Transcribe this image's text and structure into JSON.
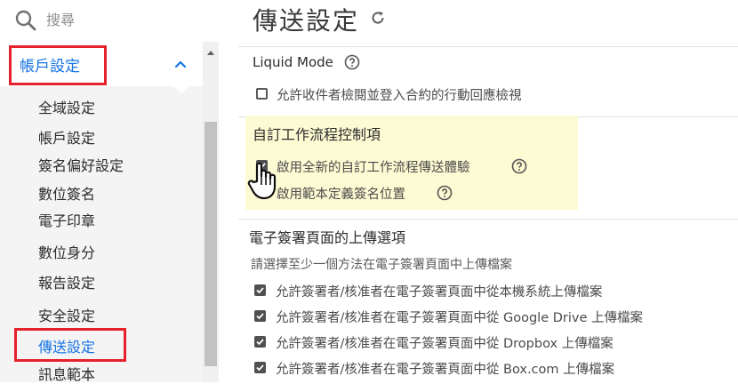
{
  "search": {
    "placeholder": "搜尋",
    "icon": "search-icon"
  },
  "sidebar": {
    "section": {
      "label": "帳戶設定",
      "expanded": true
    },
    "items": [
      {
        "label": "全域設定"
      },
      {
        "label": "帳戶設定"
      },
      {
        "label": "簽名偏好設定"
      },
      {
        "label": "數位簽名"
      },
      {
        "label": "電子印章"
      },
      {
        "label": "數位身分"
      },
      {
        "label": "報告設定"
      },
      {
        "label": "安全設定"
      },
      {
        "label": "傳送設定",
        "active": true
      },
      {
        "label": "訊息範本"
      }
    ]
  },
  "main": {
    "title": "傳送設定",
    "liquid_mode": {
      "title": "Liquid Mode",
      "option": {
        "label": "允許收件者檢閱並登入合約的行動回應檢視",
        "checked": false
      }
    },
    "custom_workflow": {
      "title": "自訂工作流程控制項",
      "options": [
        {
          "label": "啟用全新的自訂工作流程傳送體驗",
          "checked": true
        },
        {
          "label": "啟用範本定義簽名位置",
          "checked": false
        }
      ]
    },
    "upload": {
      "title": "電子簽署頁面的上傳選項",
      "description": "請選擇至少一個方法在電子簽署頁面中上傳檔案",
      "options": [
        {
          "label": "允許簽署者/核准者在電子簽署頁面中從本機系統上傳檔案",
          "checked": true
        },
        {
          "label": "允許簽署者/核准者在電子簽署頁面中從 Google Drive 上傳檔案",
          "checked": true
        },
        {
          "label": "允許簽署者/核准者在電子簽署頁面中從 Dropbox 上傳檔案",
          "checked": true
        },
        {
          "label": "允許簽署者/核准者在電子簽署頁面中從 Box.com 上傳檔案",
          "checked": true
        }
      ]
    }
  },
  "colors": {
    "accent": "#1473e6",
    "annotation_red": "#e5212c",
    "highlight": "#fdfbd3"
  }
}
